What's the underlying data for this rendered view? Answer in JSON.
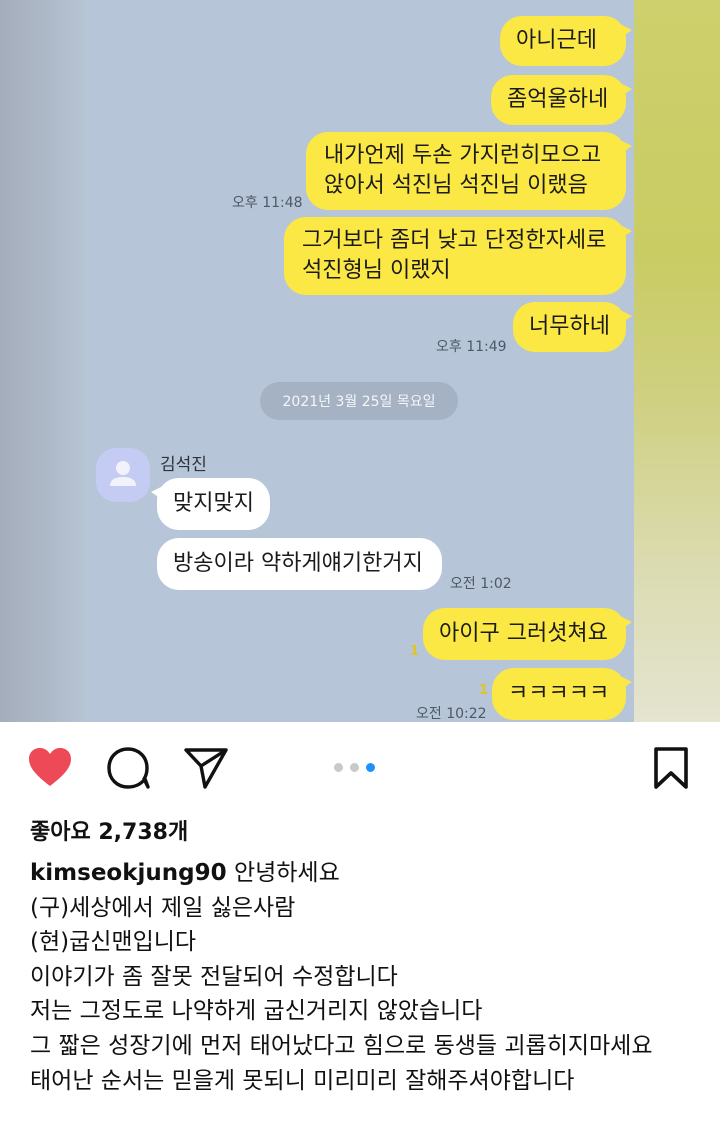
{
  "chat": {
    "messages_top": [
      {
        "text": "아니근데"
      },
      {
        "text": "좀억울하네"
      },
      {
        "line1": "내가언제 두손 가지런히모으고",
        "line2": "앉아서 석진님 석진님 이랬음",
        "time": "오후 11:48"
      },
      {
        "line1": "그거보다 좀더 낮고 단정한자세로",
        "line2": "석진형님 이랬지"
      },
      {
        "text": "너무하네",
        "time": "오후 11:49"
      }
    ],
    "date_divider": "2021년 3월 25일 목요일",
    "sender_name": "김석진",
    "received": [
      {
        "text": "맞지맞지"
      },
      {
        "text": "방송이라 약하게얘기한거지",
        "time": "오전 1:02"
      }
    ],
    "messages_bottom": [
      {
        "text": "아이구 그러셧쳐요",
        "read": "1"
      },
      {
        "text": "ㅋㅋㅋㅋㅋ",
        "read": "1",
        "time": "오전 10:22"
      }
    ]
  },
  "post": {
    "likes": "좋아요 2,738개",
    "username": "kimseokjung90",
    "caption_first": "안녕하세요",
    "caption_lines": [
      "(구)세상에서 제일 싫은사람",
      "(현)굽신맨입니다",
      "이야기가 좀 잘못 전달되어 수정합니다",
      "저는 그정도로 나약하게 굽신거리지 않았습니다",
      "그 짧은 성장기에 먼저 태어났다고 힘으로 동생들 괴롭히지마세요",
      "태어난 순서는 믿을게 못되니 미리미리 잘해주셔야합니다"
    ],
    "carousel": {
      "count": 3,
      "active": 3
    },
    "icons": [
      "heart-icon",
      "comment-icon",
      "share-icon",
      "bookmark-icon"
    ],
    "colors": {
      "like": "#ed4956",
      "dot_active": "#1e90ff",
      "bubble_me": "#fbe845"
    }
  }
}
